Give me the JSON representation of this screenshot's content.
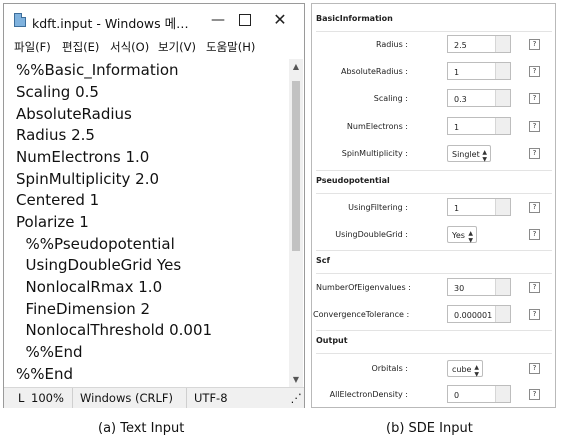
{
  "notepad": {
    "title": "kdft.input - Windows 메…",
    "controls": {
      "minimize": "—",
      "close": "✕"
    },
    "menu": [
      "파일(F)",
      "편집(E)",
      "서식(O)",
      "보기(V)",
      "도움말(H)"
    ],
    "lines": [
      "%%Basic_Information",
      "Scaling 0.5",
      "AbsoluteRadius",
      "Radius 2.5",
      "NumElectrons 1.0",
      "SpinMultiplicity 2.0",
      "Centered 1",
      "Polarize 1",
      "  %%Pseudopotential",
      "  UsingDoubleGrid Yes",
      "  NonlocalRmax 1.0",
      "  FineDimension 2",
      "  NonlocalThreshold 0.001",
      "  %%End",
      "%%End"
    ],
    "status": {
      "position": "L",
      "zoom": "100%",
      "eol": "Windows (CRLF)",
      "encoding": "UTF-8"
    }
  },
  "sde": {
    "sections": {
      "basic": "BasicInformation",
      "pseudo": "Pseudopotential",
      "scf": "Scf",
      "output": "Output"
    },
    "fields": {
      "radius": {
        "label": "Radius :",
        "value": "2.5"
      },
      "absolute_radius": {
        "label": "AbsoluteRadius :",
        "value": "1"
      },
      "scaling": {
        "label": "Scaling :",
        "value": "0.3"
      },
      "num_electrons": {
        "label": "NumElectrons :",
        "value": "1"
      },
      "spin_multiplicity": {
        "label": "SpinMultiplicity :",
        "value": "Singlet"
      },
      "using_filtering": {
        "label": "UsingFiltering :",
        "value": "1"
      },
      "using_double_grid": {
        "label": "UsingDoubleGrid :",
        "value": "Yes"
      },
      "num_eigenvalues": {
        "label": "NumberOfEigenvalues :",
        "value": "30"
      },
      "convergence_tolerance": {
        "label": "ConvergenceTolerance :",
        "value": "0.000001"
      },
      "orbitals": {
        "label": "Orbitals :",
        "value": "cube"
      },
      "all_electron_density": {
        "label": "AllElectronDensity :",
        "value": "0"
      }
    },
    "help_label": "?"
  },
  "captions": {
    "left": "(a) Text Input",
    "right": "(b) SDE Input"
  }
}
